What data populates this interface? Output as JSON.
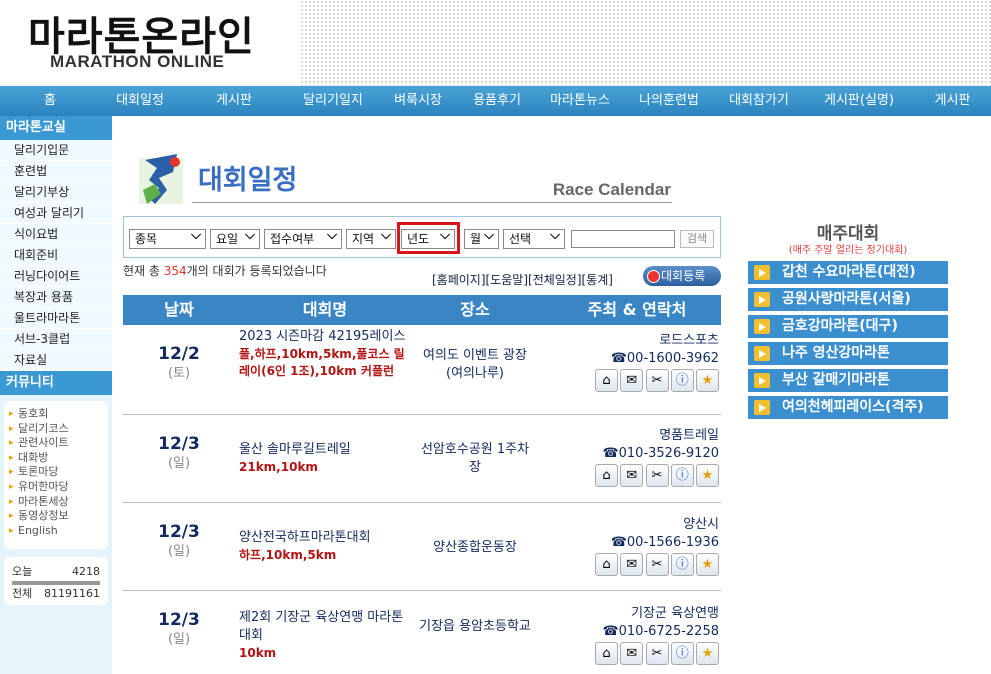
{
  "header": {
    "logo_kr": "마라톤온라인",
    "logo_en": "MARATHON ONLINE"
  },
  "nav": [
    "홈",
    "대회일정",
    "게시판",
    "달리기일지",
    "벼룩시장",
    "용품후기",
    "마라톤뉴스",
    "나의훈련법",
    "대회참가기",
    "게시판(실명)",
    "게시판"
  ],
  "sidebar": {
    "class_title": "마라톤교실",
    "class_items": [
      "달리기입문",
      "훈련법",
      "달리기부상",
      "여성과 달리기",
      "식이요법",
      "대회준비",
      "러닝다이어트",
      "복장과 용품",
      "울트라마라톤",
      "서브-3클럽",
      "자료실"
    ],
    "community_title": "커뮤니티",
    "community_items": [
      "동호회",
      "달리기코스",
      "관련사이트",
      "대화방",
      "토론마당",
      "유머한마당",
      "마라톤세상",
      "동영상정보",
      "English"
    ],
    "today_label": "오늘",
    "today_value": "4218",
    "total_label": "전체",
    "total_value": "81191161"
  },
  "title": {
    "main": "대회일정",
    "sub": "Race Calendar"
  },
  "filters": {
    "event": "종목",
    "day": "요일",
    "reception": "접수여부",
    "region": "지역",
    "year": "년도",
    "month": "월",
    "choice": "선택",
    "search_button": "검색"
  },
  "count": {
    "prefix": "현재 총 ",
    "number": "354",
    "suffix": "개의 대회가 등록되었습니다"
  },
  "links": "[홈페이지][도움말][전체일정][통계]",
  "register_button": "대회등록",
  "table": {
    "headers": [
      "날짜",
      "대회명",
      "장소",
      "주최 & 연락처"
    ],
    "rows": [
      {
        "date": "12/2",
        "weekday": "(토)",
        "name": "2023 시즌마감 42195레이스",
        "distance": "풀,하프,10km,5km,풀코스 릴레이(6인 1조),10km 커플런",
        "place": "여의도 이벤트 광장(여의나루)",
        "organizer": "로드스포츠",
        "phone": "☎00-1600-3962"
      },
      {
        "date": "12/3",
        "weekday": "(일)",
        "name": "울산 솔마루길트레일",
        "distance": "21km,10km",
        "place": "선암호수공원 1주차장",
        "organizer": "명품트레일",
        "phone": "☎010-3526-9120"
      },
      {
        "date": "12/3",
        "weekday": "(일)",
        "name": "양산전국하프마라톤대회",
        "distance": "하프,10km,5km",
        "place": "양산종합운동장",
        "organizer": "양산시",
        "phone": "☎00-1566-1936"
      },
      {
        "date": "12/3",
        "weekday": "(일)",
        "name": "제2회 기장군 육상연맹 마라톤대회",
        "distance": "10km",
        "place": "기장읍 용암초등학교",
        "organizer": "기장군 육상연맹",
        "phone": "☎010-6725-2258"
      }
    ]
  },
  "weekly": {
    "title": "매주대회",
    "subtitle": "(매주 주말 열리는 정기대회)",
    "items": [
      "갑천 수요마라톤(대전)",
      "공원사랑마라톤(서울)",
      "금호강마라톤(대구)",
      "나주 영산강마라톤",
      "부산 갈매기마라톤",
      "여의천헤피레이스(격주)"
    ]
  },
  "icons": [
    "home-icon",
    "map-icon",
    "tools-icon",
    "info-icon",
    "star-icon"
  ]
}
